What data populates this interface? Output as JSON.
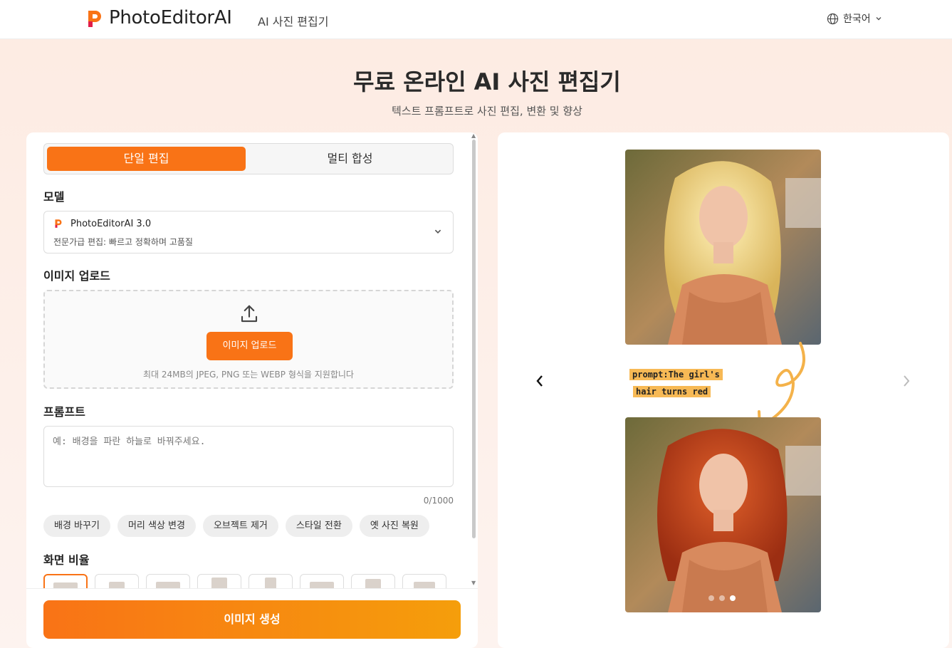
{
  "header": {
    "brand": "PhotoEditorAI",
    "nav_link": "AI 사진 편집기",
    "language": "한국어"
  },
  "hero": {
    "title": "무료 온라인 AI 사진 편집기",
    "subtitle": "텍스트 프롬프트로 사진 편집, 변환 및 향상"
  },
  "editor": {
    "tabs": [
      {
        "label": "단일 편집",
        "active": true
      },
      {
        "label": "멀티 합성",
        "active": false
      }
    ],
    "model_label": "모델",
    "model": {
      "name": "PhotoEditorAI 3.0",
      "description": "전문가급 편집: 빠르고 정확하며 고품질"
    },
    "upload_label": "이미지 업로드",
    "upload": {
      "button": "이미지 업로드",
      "hint": "최대 24MB의 JPEG, PNG 또는 WEBP 형식을 지원합니다"
    },
    "prompt_label": "프롬프트",
    "prompt": {
      "placeholder": "예: 배경을 파란 하늘로 바꿔주세요.",
      "value": "",
      "char_count": "0/1000"
    },
    "quick_prompts": [
      "배경 바꾸기",
      "머리 색상 변경",
      "오브젝트 제거",
      "스타일 전환",
      "옛 사진 복원"
    ],
    "ratio_label": "화면 비율",
    "generate_button": "이미지 생성"
  },
  "preview": {
    "prompt_lines": [
      "prompt:The girl's",
      "hair turns red"
    ],
    "slides_total": 3,
    "active_slide": 3
  },
  "colors": {
    "accent": "#f97316",
    "accent_end": "#f59e0b",
    "annotation": "#f7b955"
  }
}
